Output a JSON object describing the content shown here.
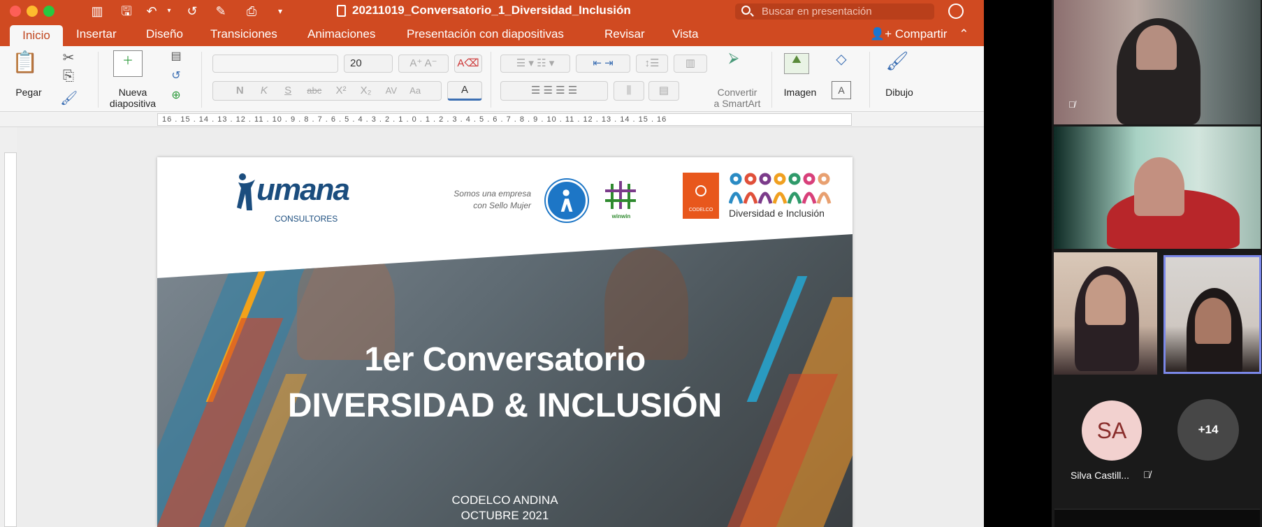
{
  "window": {
    "title": "20211019_Conversatorio_1_Diversidad_Inclusión",
    "search_placeholder": "Buscar en presentación"
  },
  "tabs": [
    {
      "label": "Inicio",
      "active": true
    },
    {
      "label": "Insertar"
    },
    {
      "label": "Diseño"
    },
    {
      "label": "Transiciones"
    },
    {
      "label": "Animaciones"
    },
    {
      "label": "Presentación con diapositivas"
    },
    {
      "label": "Revisar"
    },
    {
      "label": "Vista"
    }
  ],
  "share_label": "Compartir",
  "ribbon": {
    "paste_label": "Pegar",
    "new_slide_line1": "Nueva",
    "new_slide_line2": "diapositiva",
    "font_size": "20",
    "bold": "N",
    "italic": "K",
    "underline": "S",
    "strike": "abc",
    "superscript": "X²",
    "subscript": "X₂",
    "char_spacing": "AV",
    "change_case": "Aa",
    "smartart_line1": "Convertir",
    "smartart_line2": "a SmartArt",
    "image_label": "Imagen",
    "drawing_label": "Dibujo"
  },
  "ruler_text": "16 . 15 . 14 . 13 . 12 . 11 . 10 . 9 . 8 . 7 . 6 . 5 . 4 . 3 . 2 . 1 . 0 . 1 . 2 . 3 . 4 . 5 . 6 . 7 . 8 . 9 . 10 . 11 . 12 . 13 . 14 . 15 . 16",
  "slide": {
    "logo_humana": "umana",
    "logo_humana_sub": "CONSULTORES",
    "sello_line1": "Somos una empresa",
    "sello_line2": "con Sello Mujer",
    "winwin_label": "winwin",
    "codelco_label": "CODELCO",
    "diversidad_label": "Diversidad e Inclusión",
    "title_line1": "1er Conversatorio",
    "title_line2": "DIVERSIDAD & INCLUSIÓN",
    "company": "CODELCO ANDINA",
    "date": "OCTUBRE 2021"
  },
  "participants": {
    "avatar_initials": "SA",
    "avatar_name": "Silva Castill...",
    "more_count": "+14"
  },
  "colors": {
    "ppt_orange": "#d04a21",
    "humana_blue": "#1b4d7e",
    "codelco_orange": "#e8571c",
    "active_speaker": "#7b88e8"
  }
}
